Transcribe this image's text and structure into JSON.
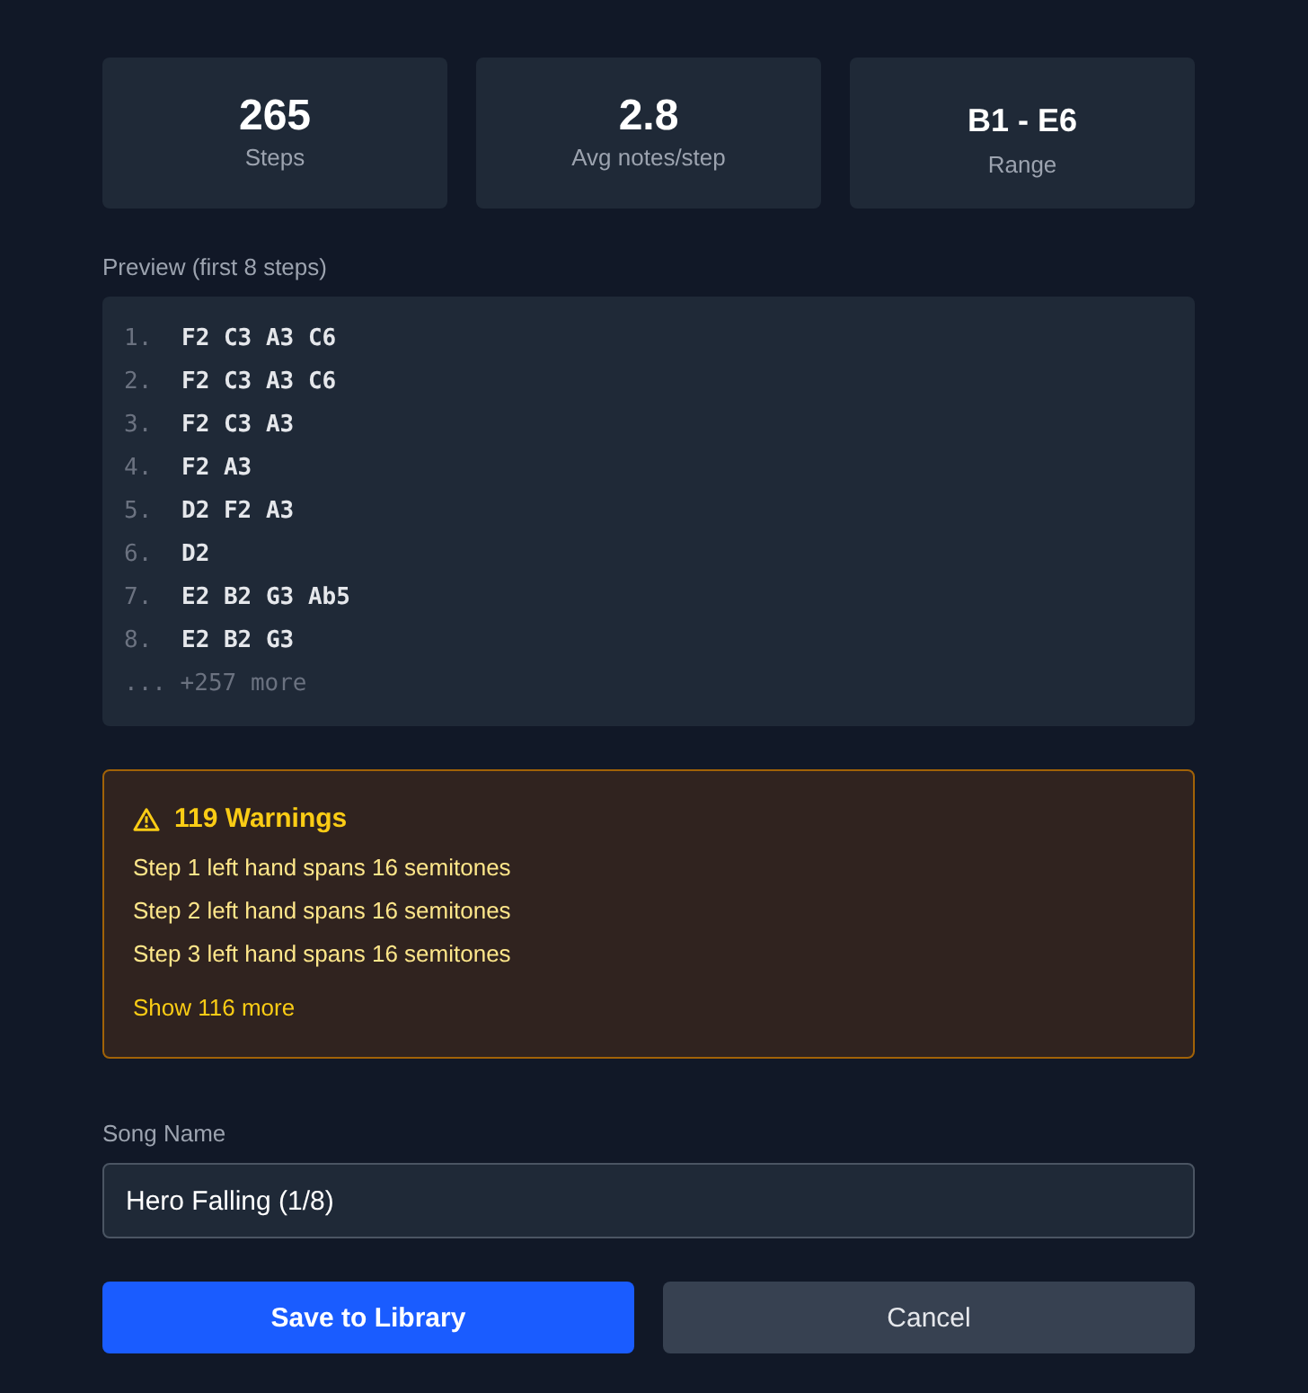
{
  "stats": [
    {
      "kind": "number",
      "value": "265",
      "label": "Steps"
    },
    {
      "kind": "number",
      "value": "2.8",
      "label": "Avg notes/step"
    },
    {
      "kind": "text",
      "value": "B1 - E6",
      "label": "Range"
    }
  ],
  "preview": {
    "label": "Preview (first 8 steps)",
    "lines": [
      {
        "number": "1.",
        "notes": "F2 C3 A3 C6"
      },
      {
        "number": "2.",
        "notes": "F2 C3 A3 C6"
      },
      {
        "number": "3.",
        "notes": "F2 C3 A3"
      },
      {
        "number": "4.",
        "notes": "F2 A3"
      },
      {
        "number": "5.",
        "notes": "D2 F2 A3"
      },
      {
        "number": "6.",
        "notes": "D2"
      },
      {
        "number": "7.",
        "notes": "E2 B2 G3 Ab5"
      },
      {
        "number": "8.",
        "notes": "E2 B2 G3"
      }
    ],
    "more": "... +257 more"
  },
  "warnings": {
    "title": "119 Warnings",
    "items": [
      "Step 1 left hand spans 16 semitones",
      "Step 2 left hand spans 16 semitones",
      "Step 3 left hand spans 16 semitones"
    ],
    "show_more": "Show 116 more"
  },
  "song_name": {
    "label": "Song Name",
    "value": "Hero Falling (1/8)"
  },
  "buttons": [
    {
      "kind": "primary",
      "label": "Save to Library"
    },
    {
      "kind": "secondary",
      "label": "Cancel"
    }
  ]
}
